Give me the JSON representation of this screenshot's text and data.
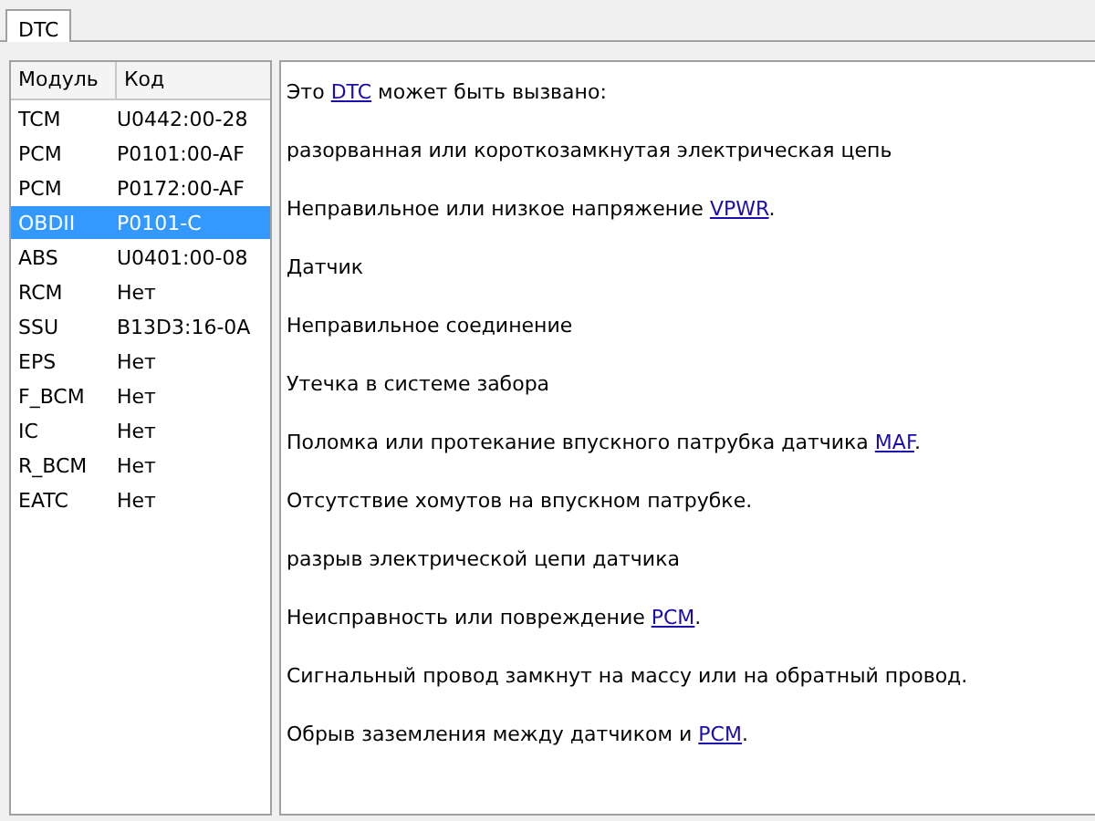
{
  "tabs": [
    {
      "label": "DTC",
      "selected": true
    }
  ],
  "table": {
    "columns": [
      "Модуль",
      "Код"
    ],
    "rows": [
      {
        "module": "TCM",
        "code": "U0442:00-28",
        "selected": false
      },
      {
        "module": "PCM",
        "code": "P0101:00-AF",
        "selected": false
      },
      {
        "module": "PCM",
        "code": "P0172:00-AF",
        "selected": false
      },
      {
        "module": "OBDII",
        "code": "P0101-C",
        "selected": true
      },
      {
        "module": "ABS",
        "code": "U0401:00-08",
        "selected": false
      },
      {
        "module": "RCM",
        "code": "Нет",
        "selected": false
      },
      {
        "module": "SSU",
        "code": "B13D3:16-0A",
        "selected": false
      },
      {
        "module": "EPS",
        "code": "Нет",
        "selected": false
      },
      {
        "module": "F_BCM",
        "code": "Нет",
        "selected": false
      },
      {
        "module": "IC",
        "code": "Нет",
        "selected": false
      },
      {
        "module": "R_BCM",
        "code": "Нет",
        "selected": false
      },
      {
        "module": "EATC",
        "code": "Нет",
        "selected": false
      }
    ]
  },
  "description": [
    {
      "parts": [
        {
          "text": "Это ",
          "link": false
        },
        {
          "text": "DTC",
          "link": true
        },
        {
          "text": " может быть вызвано:",
          "link": false
        }
      ]
    },
    {
      "parts": [
        {
          "text": "разорванная или короткозамкнутая электрическая цепь",
          "link": false
        }
      ]
    },
    {
      "parts": [
        {
          "text": "Неправильное или низкое напряжение ",
          "link": false
        },
        {
          "text": "VPWR",
          "link": true
        },
        {
          "text": ".",
          "link": false
        }
      ]
    },
    {
      "parts": [
        {
          "text": "Датчик",
          "link": false
        }
      ]
    },
    {
      "parts": [
        {
          "text": "Неправильное соединение",
          "link": false
        }
      ]
    },
    {
      "parts": [
        {
          "text": "Утечка в системе забора",
          "link": false
        }
      ]
    },
    {
      "parts": [
        {
          "text": "Поломка или протекание впускного патрубка датчика ",
          "link": false
        },
        {
          "text": "MAF",
          "link": true
        },
        {
          "text": ".",
          "link": false
        }
      ]
    },
    {
      "parts": [
        {
          "text": "Отсутствие хомутов на впускном патрубке.",
          "link": false
        }
      ]
    },
    {
      "parts": [
        {
          "text": "разрыв электрической цепи датчика",
          "link": false
        }
      ]
    },
    {
      "parts": [
        {
          "text": "Неисправность или повреждение ",
          "link": false
        },
        {
          "text": "PCM",
          "link": true
        },
        {
          "text": ".",
          "link": false
        }
      ]
    },
    {
      "parts": [
        {
          "text": "Сигнальный провод замкнут на массу или на обратный провод.",
          "link": false
        }
      ]
    },
    {
      "parts": [
        {
          "text": "Обрыв заземления между датчиком и ",
          "link": false
        },
        {
          "text": "PCM",
          "link": true
        },
        {
          "text": ".",
          "link": false
        }
      ]
    }
  ]
}
